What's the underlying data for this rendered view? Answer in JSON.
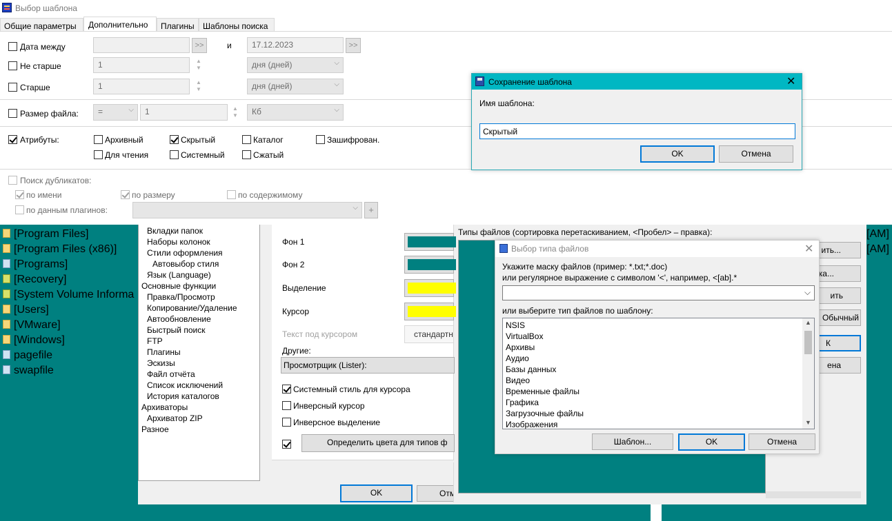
{
  "window": {
    "title": "Выбор шаблона"
  },
  "tabs": [
    {
      "label": "Общие параметры"
    },
    {
      "label": "Дополнительно"
    },
    {
      "label": "Плагины"
    },
    {
      "label": "Шаблоны поиска"
    }
  ],
  "date_between": {
    "label": "Дата между",
    "from_value": "",
    "and_label": "и",
    "to_value": "17.12.2023",
    "arrows": ">>"
  },
  "not_older": {
    "label": "Не старше",
    "value": "1",
    "unit": "дня (дней)"
  },
  "older": {
    "label": "Старше",
    "value": "1",
    "unit": "дня (дней)"
  },
  "file_size": {
    "label": "Размер файла:",
    "operator": "=",
    "value": "1",
    "unit": "Кб"
  },
  "attributes": {
    "label": "Атрибуты:",
    "items": {
      "archive": "Архивный",
      "hidden": "Скрытый",
      "directory": "Каталог",
      "encrypted": "Зашифрован.",
      "readonly": "Для чтения",
      "system": "Системный",
      "compressed": "Сжатый"
    }
  },
  "duplicates": {
    "label": "Поиск дубликатов:",
    "by_name": "по имени",
    "by_size": "по размеру",
    "by_content": "по содержимому",
    "by_plugins": "по данным плагинов:",
    "plus": "+"
  },
  "background_panel": {
    "files": [
      {
        "name": "[Program Files]",
        "icon": "folder-icon"
      },
      {
        "name": "[Program Files (x86)]",
        "icon": "folder-icon"
      },
      {
        "name": "[Programs]",
        "icon": "link-folder-icon"
      },
      {
        "name": "[Recovery]",
        "icon": "locked-folder-icon"
      },
      {
        "name": "[System Volume Informa",
        "icon": "locked-folder-icon"
      },
      {
        "name": "[Users]",
        "icon": "folder-icon"
      },
      {
        "name": "[VMware]",
        "icon": "folder-icon"
      },
      {
        "name": "[Windows]",
        "icon": "folder-icon"
      },
      {
        "name": "pagefile",
        "icon": "system-file-icon"
      },
      {
        "name": "swapfile",
        "icon": "system-file-icon"
      }
    ],
    "right_fragments": [
      "[AM]",
      "[AM]"
    ],
    "right_button_fragments": [
      "ить...",
      "ка...",
      "ить",
      "Обычный",
      "К",
      "ена"
    ]
  },
  "settings_tree": {
    "items": [
      {
        "label": "Вкладки папок",
        "indent": 1
      },
      {
        "label": "Наборы колонок",
        "indent": 1
      },
      {
        "label": "Стили оформления",
        "indent": 1
      },
      {
        "label": "Автовыбор стиля",
        "indent": 2
      },
      {
        "label": "Язык (Language)",
        "indent": 1
      },
      {
        "label": "Основные функции",
        "indent": 0
      },
      {
        "label": "Правка/Просмотр",
        "indent": 1
      },
      {
        "label": "Копирование/Удаление",
        "indent": 1
      },
      {
        "label": "Автообновление",
        "indent": 1
      },
      {
        "label": "Быстрый поиск",
        "indent": 1
      },
      {
        "label": "FTP",
        "indent": 1
      },
      {
        "label": "Плагины",
        "indent": 1
      },
      {
        "label": "Эскизы",
        "indent": 1
      },
      {
        "label": "Файл отчёта",
        "indent": 1
      },
      {
        "label": "Список исключений",
        "indent": 1
      },
      {
        "label": "История каталогов",
        "indent": 1
      },
      {
        "label": "Архиваторы",
        "indent": 0
      },
      {
        "label": "Архиватор ZIP",
        "indent": 1
      },
      {
        "label": "Разное",
        "indent": 0
      }
    ]
  },
  "colors_panel": {
    "bg1": "Фон 1",
    "bg2": "Фон 2",
    "selection": "Выделение",
    "cursor": "Курсор",
    "cursor_text": "Текст под курсором",
    "cursor_text_value": "стандартн",
    "other": "Другие:",
    "other_value": "Просмотрщик (Lister):",
    "system_cursor": "Системный стиль для курсора",
    "inverse_cursor": "Инверсный курсор",
    "inverse_selection": "Инверсное выделение",
    "define_colors_button": "Определить цвета для типов ф",
    "ok": "OK",
    "cancel_fragment": "Отм",
    "teal": "#008080",
    "yellow": "#ffff00"
  },
  "file_types_header": "Типы файлов (сортировка перетаскиванием, <Пробел> – правка):",
  "save_dialog": {
    "title": "Сохранение шаблона",
    "prompt": "Имя шаблона:",
    "value": "Скрытый",
    "ok": "OK",
    "cancel": "Отмена",
    "title_bg": "#00b7c3"
  },
  "filetype_dialog": {
    "title": "Выбор типа файлов",
    "instruction1": "Укажите маску файлов (пример: *.txt;*.doc)",
    "instruction2": "или регулярное выражение с символом '<', например, <[ab].*",
    "mask_value": "",
    "or_choose": "или выберите тип файлов по шаблону:",
    "types": [
      "NSIS",
      "VirtualBox",
      "Архивы",
      "Аудио",
      "Базы данных",
      "Видео",
      "Временные файлы",
      "Графика",
      "Загрузочные файлы",
      "Изображения"
    ],
    "template_button": "Шаблон...",
    "ok": "OK",
    "cancel": "Отмена"
  }
}
